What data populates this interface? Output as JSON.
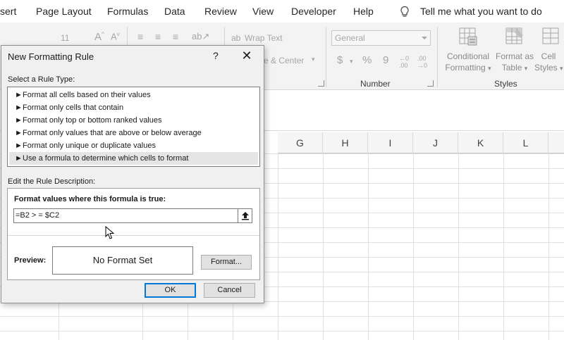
{
  "ribbon_tabs": [
    "sert",
    "Page Layout",
    "Formulas",
    "Data",
    "Review",
    "View",
    "Developer",
    "Help"
  ],
  "tell_me": "Tell me what you want to do",
  "ribbon": {
    "font_size": "11",
    "wrap_text": "Wrap Text",
    "merge_center": "e & Center",
    "number_format": "General",
    "number_symbols": {
      "currency": "$",
      "percent": "%",
      "comma": "9"
    },
    "number_group_label": "Number",
    "conditional_formatting": [
      "Conditional",
      "Formatting"
    ],
    "format_as_table": [
      "Format as",
      "Table"
    ],
    "cell_styles": [
      "Cell",
      "Styles"
    ],
    "styles_group_label": "Styles"
  },
  "columns": [
    "G",
    "H",
    "I",
    "J",
    "K",
    "L"
  ],
  "dialog": {
    "title": "New Formatting Rule",
    "help": "?",
    "close": "✕",
    "select_rule_type_label": "Select a Rule Type:",
    "rule_types": [
      "Format all cells based on their values",
      "Format only cells that contain",
      "Format only top or bottom ranked values",
      "Format only values that are above or below average",
      "Format only unique or duplicate values",
      "Use a formula to determine which cells to format"
    ],
    "selected_rule_index": 5,
    "edit_description_label": "Edit the Rule Description:",
    "formula_prompt": "Format values where this formula is true:",
    "formula_value": "=B2 > = $C2",
    "preview_label": "Preview:",
    "preview_text": "No Format Set",
    "format_button": "Format...",
    "ok_button": "OK",
    "cancel_button": "Cancel"
  },
  "colors": {
    "accent": "#0078d7",
    "selection": "#e5e5e5",
    "dialog_bg": "#f0f0f0"
  }
}
